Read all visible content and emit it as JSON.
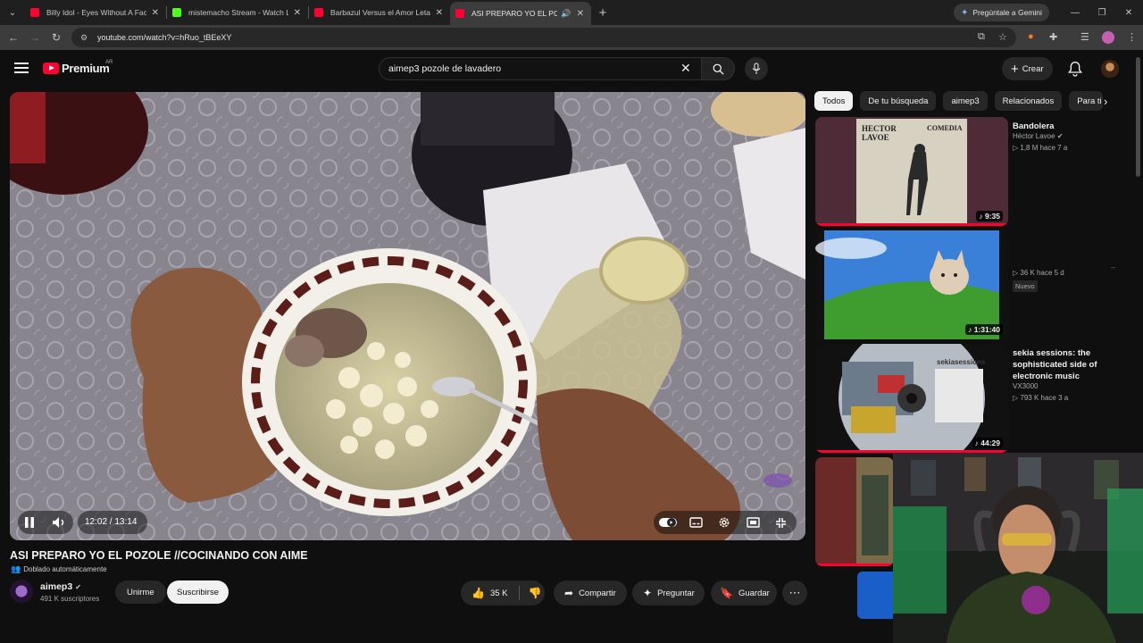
{
  "browser": {
    "tabs": [
      {
        "title": "Billy Idol - Eyes Without A Face",
        "favicon": "youtube-icon",
        "active": false
      },
      {
        "title": "mistemacho Stream - Watch Live",
        "favicon": "kick-icon",
        "active": false
      },
      {
        "title": "Barbazul Versus el Amor Letal",
        "favicon": "youtube-icon",
        "active": false
      },
      {
        "title": "ASI PREPARO YO EL POZOLE",
        "favicon": "youtube-icon",
        "active": true
      }
    ],
    "gemini_label": "Pregúntale a Gemini",
    "url": "youtube.com/watch?v=hRuo_tBEeXY"
  },
  "masthead": {
    "logo_text": "Premium",
    "country_code": "AR",
    "search_value": "aimep3 pozole de lavadero",
    "create_label": "Crear"
  },
  "player": {
    "time_display": "12:02 / 13:14",
    "progress": 0.909,
    "colors": {
      "accent": "#ff0033"
    }
  },
  "video": {
    "title": "ASI PREPARO YO EL POZOLE //COCINANDO CON AIME",
    "dubbed_label": "Doblado automáticamente",
    "channel_name": "aimep3",
    "subscribers": "491 K suscriptores",
    "join_label": "Unirme",
    "subscribe_label": "Suscribirse",
    "likes": "35 K",
    "share_label": "Compartir",
    "ask_label": "Preguntar",
    "save_label": "Guardar"
  },
  "chips": [
    "Todos",
    "De tu búsqueda",
    "aimep3",
    "Relacionados",
    "Para ti"
  ],
  "recommendations": [
    {
      "title": "Bandolera",
      "channel": "Héctor Lavoe",
      "meta": "1,8 M   hace 7 a",
      "duration": "9:35",
      "thumb_text_1": "HECTOR",
      "thumb_text_2": "LAVOE",
      "thumb_text_3": "COMEDIA"
    },
    {
      "title": "",
      "channel": "",
      "meta": "36 K   hace 5 d",
      "badge": "Nuevo",
      "duration": "1:31:40"
    },
    {
      "title": "sekia sessions: the sophisticated side of electronic music",
      "channel": "VX3000",
      "meta": "793 K   hace 3 a",
      "duration": "44:29",
      "thumb_text": "sekiasessions"
    },
    {
      "title": "",
      "channel": "",
      "meta": "",
      "duration": ""
    }
  ]
}
